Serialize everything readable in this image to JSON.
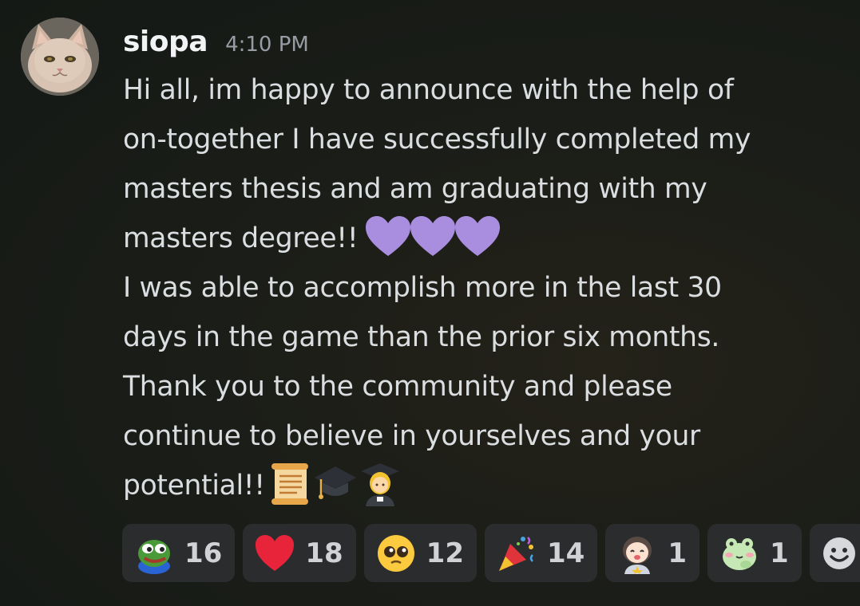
{
  "message": {
    "username": "siopa",
    "timestamp": "4:10 PM",
    "lines": [
      "Hi all, im happy to announce with the help of",
      "on-together I have successfully completed my",
      "masters thesis and am graduating with my",
      "masters degree!!",
      "I was able to accomplish more in the last 30",
      "days in the game than the prior six months.",
      "Thank you to the community and please",
      "continue to believe in yourselves and your",
      "potential!!"
    ],
    "inline_emojis": {
      "degree_line": [
        "purple-heart",
        "purple-heart",
        "purple-heart"
      ],
      "potential_line": [
        "scroll",
        "graduation-cap",
        "woman-student"
      ]
    }
  },
  "reactions": [
    {
      "icon": "pepe-frog-emoji",
      "count": "16"
    },
    {
      "icon": "red-heart-emoji",
      "count": "18"
    },
    {
      "icon": "pleading-face-emoji",
      "count": "12"
    },
    {
      "icon": "party-popper-emoji",
      "count": "14"
    },
    {
      "icon": "anime-girl-sticker-emoji",
      "count": "1"
    },
    {
      "icon": "blushing-frog-emoji",
      "count": "1"
    }
  ],
  "add_reaction": {
    "icon": "add-reaction-smiley-icon"
  },
  "colors": {
    "background": "#1b1d18",
    "reaction_pill": "#2b2c2e",
    "purple_heart": "#a98ee0",
    "red_heart": "#e8243b"
  }
}
